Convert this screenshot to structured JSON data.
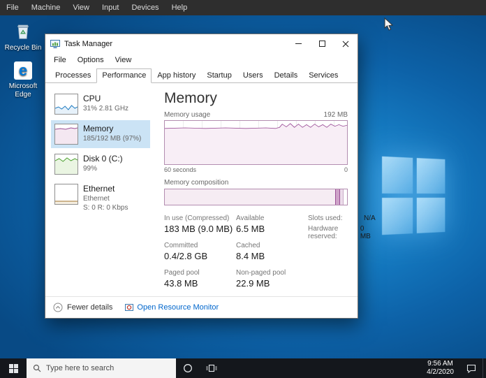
{
  "vbox": {
    "menu": [
      "File",
      "Machine",
      "View",
      "Input",
      "Devices",
      "Help"
    ]
  },
  "desktop": {
    "icons": [
      {
        "label": "Recycle Bin"
      },
      {
        "label": "Microsoft Edge"
      }
    ],
    "edge_glyph": "e"
  },
  "task_manager": {
    "title": "Task Manager",
    "menu": [
      "File",
      "Options",
      "View"
    ],
    "tabs": [
      "Processes",
      "Performance",
      "App history",
      "Startup",
      "Users",
      "Details",
      "Services"
    ],
    "sidebar": {
      "cpu": {
        "name": "CPU",
        "detail": "31% 2.81 GHz"
      },
      "memory": {
        "name": "Memory",
        "detail": "185/192 MB (97%)"
      },
      "disk": {
        "name": "Disk 0 (C:)",
        "detail": "99%"
      },
      "ethernet": {
        "name": "Ethernet",
        "detail": "Ethernet",
        "detail2": "S: 0 R: 0 Kbps"
      }
    },
    "main": {
      "title": "Memory",
      "scale_max": "192 MB",
      "usage_label": "Memory usage",
      "time_left": "60 seconds",
      "time_right": "0",
      "composition_label": "Memory composition",
      "stats": {
        "in_use": {
          "label": "In use (Compressed)",
          "value": "183 MB (9.0 MB)"
        },
        "available": {
          "label": "Available",
          "value": "6.5 MB"
        },
        "committed": {
          "label": "Committed",
          "value": "0.4/2.8 GB"
        },
        "cached": {
          "label": "Cached",
          "value": "8.4 MB"
        },
        "paged_pool": {
          "label": "Paged pool",
          "value": "43.8 MB"
        },
        "non_paged_pool": {
          "label": "Non-paged pool",
          "value": "22.9 MB"
        },
        "slots_used": {
          "label": "Slots used:",
          "value": "N/A"
        },
        "hardware_reserved": {
          "label": "Hardware reserved:",
          "value": "0 MB"
        }
      }
    },
    "footer": {
      "details_toggle": "Fewer details",
      "resource_link": "Open Resource Monitor"
    }
  },
  "taskbar": {
    "search_placeholder": "Type here to search",
    "clock": {
      "time": "9:56 AM",
      "date": "4/2/2020"
    }
  },
  "colors": {
    "memory_accent": "#9b4f97",
    "cpu_accent": "#1b79c0",
    "disk_accent": "#4aa02c",
    "selection": "#cbe3f5",
    "link": "#0066cc"
  }
}
